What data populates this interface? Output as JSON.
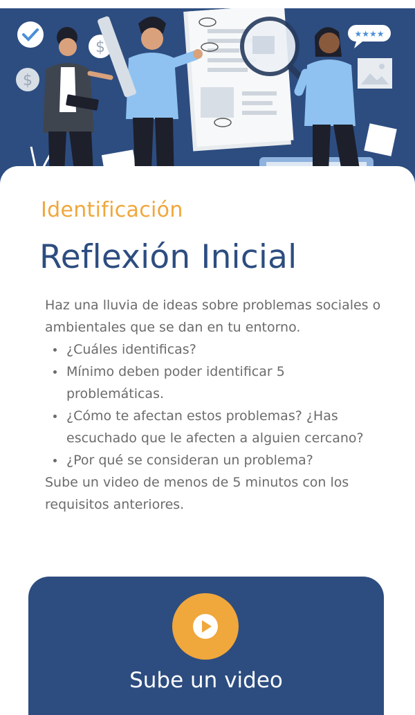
{
  "header": {
    "eyebrow": "Identificación",
    "title": "Reflexión Inicial"
  },
  "illustration": {
    "icons": [
      "check-icon",
      "dollar-icon",
      "magnifier-icon",
      "rating-stars-icon",
      "document-icon",
      "image-icon"
    ],
    "colors": {
      "background": "#2d4d80",
      "accent": "#f0a73c",
      "light_blue": "#8fc2f0"
    }
  },
  "content": {
    "intro": "Haz una lluvia de ideas sobre problemas sociales o ambientales que se dan en tu entorno.",
    "bullets": [
      "¿Cuáles identificas?",
      "Mínimo deben poder identificar 5 problemáticas.",
      "¿Cómo te afectan estos problemas? ¿Has escuchado que le afecten a alguien cercano?",
      "¿Por qué se consideran un problema?"
    ],
    "outro": "Sube un video de menos de 5 minutos con los requisitos anteriores."
  },
  "upload": {
    "label": "Sube un video",
    "icon": "play-icon"
  },
  "colors": {
    "primary": "#2d4d80",
    "accent": "#f0a73c",
    "text": "#6b6b6b"
  }
}
